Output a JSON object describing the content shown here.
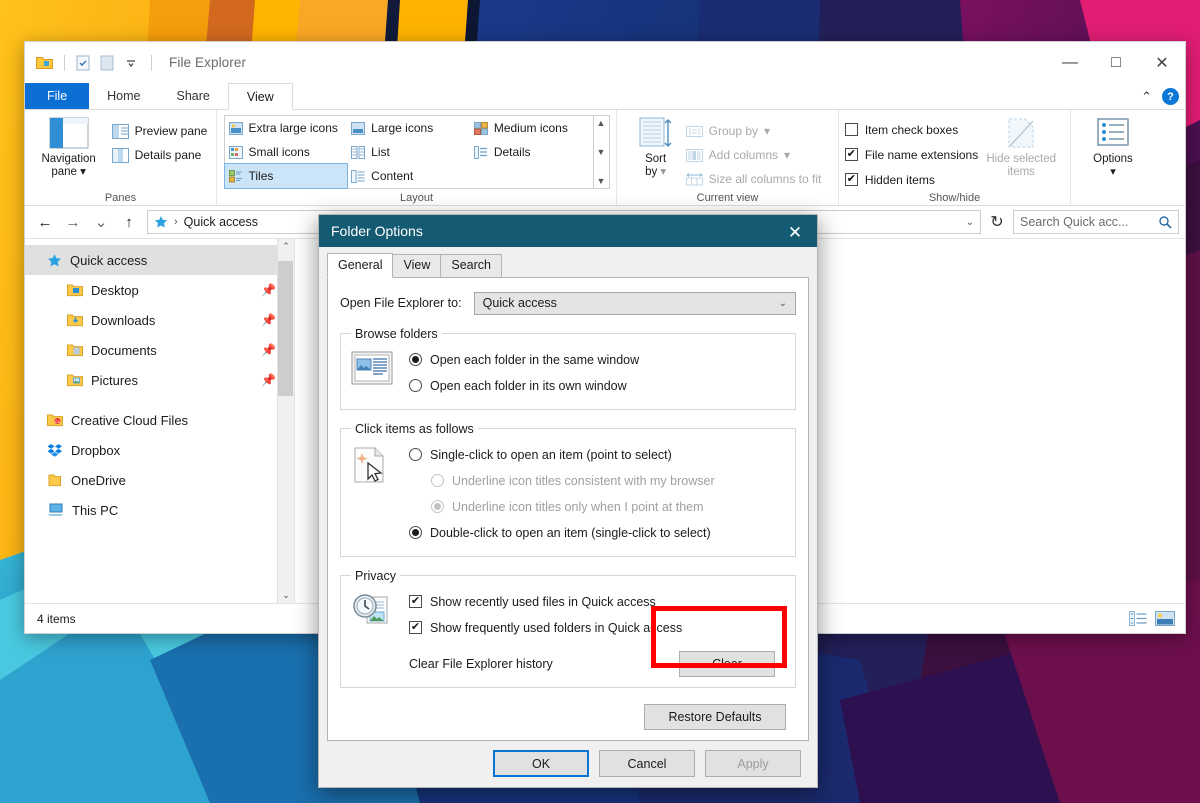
{
  "window": {
    "title": "File Explorer",
    "quick_access_toolbar": [
      "folder-icon",
      "properties-icon",
      "new-folder-icon",
      "customize-chevron-icon"
    ],
    "controls": {
      "minimize": "—",
      "maximize": "□",
      "close": "✕"
    },
    "ribbon_collapse": "⌃",
    "help": "?"
  },
  "ribbon": {
    "tabs": [
      {
        "label": "File",
        "type": "file"
      },
      {
        "label": "Home",
        "type": "normal"
      },
      {
        "label": "Share",
        "type": "normal"
      },
      {
        "label": "View",
        "type": "active"
      }
    ],
    "groups": [
      {
        "name": "Panes",
        "label": "Panes",
        "big_button": {
          "label_line1": "Navigation",
          "label_line2": "pane",
          "icon": "navigation-pane-icon",
          "has_dropdown": true
        },
        "items": [
          {
            "label": "Preview pane",
            "icon": "preview-pane-icon"
          },
          {
            "label": "Details pane",
            "icon": "details-pane-icon"
          }
        ]
      },
      {
        "name": "Layout",
        "label": "Layout",
        "gallery": [
          {
            "label": "Extra large icons",
            "icon": "extra-large-icons-icon",
            "selected": false
          },
          {
            "label": "Large icons",
            "icon": "large-icons-icon",
            "selected": false
          },
          {
            "label": "Medium icons",
            "icon": "medium-icons-icon",
            "selected": false
          },
          {
            "label": "Small icons",
            "icon": "small-icons-icon",
            "selected": false
          },
          {
            "label": "List",
            "icon": "list-view-icon",
            "selected": false
          },
          {
            "label": "Details",
            "icon": "details-view-icon",
            "selected": false
          },
          {
            "label": "Tiles",
            "icon": "tiles-view-icon",
            "selected": true
          },
          {
            "label": "Content",
            "icon": "content-view-icon",
            "selected": false
          }
        ]
      },
      {
        "name": "Current view",
        "label": "Current view",
        "big_button": {
          "label_line1": "Sort",
          "label_line2": "by",
          "icon": "sort-by-icon",
          "has_dropdown": true
        },
        "items": [
          {
            "label": "Group by",
            "icon": "group-by-icon",
            "dim": true,
            "has_dropdown": true
          },
          {
            "label": "Add columns",
            "icon": "add-columns-icon",
            "dim": true,
            "has_dropdown": true
          },
          {
            "label": "Size all columns to fit",
            "icon": "size-columns-icon",
            "dim": true,
            "has_dropdown": false
          }
        ]
      },
      {
        "name": "Show/hide",
        "label": "Show/hide",
        "checkboxes": [
          {
            "label": "Item check boxes",
            "checked": false
          },
          {
            "label": "File name extensions",
            "checked": true
          },
          {
            "label": "Hidden items",
            "checked": true
          }
        ],
        "big_button": {
          "label_line1": "Hide selected",
          "label_line2": "items",
          "icon": "hide-selected-items-icon",
          "dim": true
        }
      },
      {
        "name": "Options",
        "label": "",
        "big_button": {
          "label_line1": "Options",
          "label_line2": "",
          "icon": "options-icon",
          "has_dropdown": true
        }
      }
    ]
  },
  "address": {
    "back": "←",
    "forward": "→",
    "recent": "⌄",
    "up": "↑",
    "crumb_icon": "quick-access-star-icon",
    "crumb": "Quick access",
    "separator": "›",
    "dropdown": "⌄",
    "refresh": "↻",
    "search_placeholder": "Search Quick acc...",
    "search_icon": "search-icon"
  },
  "navpane": {
    "items": [
      {
        "label": "Quick access",
        "icon": "quick-access-star-icon",
        "selected": true,
        "child": false,
        "pinned": false
      },
      {
        "label": "Desktop",
        "icon": "desktop-folder-icon",
        "selected": false,
        "child": true,
        "pinned": true
      },
      {
        "label": "Downloads",
        "icon": "downloads-folder-icon",
        "selected": false,
        "child": true,
        "pinned": true
      },
      {
        "label": "Documents",
        "icon": "documents-folder-icon",
        "selected": false,
        "child": true,
        "pinned": true
      },
      {
        "label": "Pictures",
        "icon": "pictures-folder-icon",
        "selected": false,
        "child": true,
        "pinned": true
      },
      {
        "label": "Creative Cloud Files",
        "icon": "creative-cloud-folder-icon",
        "selected": false,
        "child": false,
        "pinned": false
      },
      {
        "label": "Dropbox",
        "icon": "dropbox-icon",
        "selected": false,
        "child": false,
        "pinned": false
      },
      {
        "label": "OneDrive",
        "icon": "onedrive-folder-icon",
        "selected": false,
        "child": false,
        "pinned": false
      },
      {
        "label": "This PC",
        "icon": "this-pc-icon",
        "selected": false,
        "child": false,
        "pinned": false
      }
    ],
    "scroll_up": "⌃",
    "scroll_down": "⌄"
  },
  "status": {
    "item_count": "4 items",
    "view_details_icon": "details-view-toggle-icon",
    "view_large_icon": "large-icons-view-toggle-icon"
  },
  "dialog": {
    "title": "Folder Options",
    "close": "✕",
    "tabs": [
      {
        "label": "General",
        "active": true
      },
      {
        "label": "View",
        "active": false
      },
      {
        "label": "Search",
        "active": false
      }
    ],
    "open_to": {
      "label": "Open File Explorer to:",
      "value": "Quick access",
      "chevron": "⌄"
    },
    "browse_folders": {
      "legend": "Browse folders",
      "icon": "browse-folders-icon",
      "options": [
        {
          "label": "Open each folder in the same window",
          "checked": true
        },
        {
          "label": "Open each folder in its own window",
          "checked": false
        }
      ]
    },
    "click_items": {
      "legend": "Click items as follows",
      "icon": "click-items-icon",
      "options": [
        {
          "label": "Single-click to open an item (point to select)",
          "checked": false,
          "sub": false,
          "dim": false
        },
        {
          "label": "Underline icon titles consistent with my browser",
          "checked": false,
          "sub": true,
          "dim": true
        },
        {
          "label": "Underline icon titles only when I point at them",
          "checked": true,
          "sub": true,
          "dim": true
        },
        {
          "label": "Double-click to open an item (single-click to select)",
          "checked": true,
          "sub": false,
          "dim": false
        }
      ]
    },
    "privacy": {
      "legend": "Privacy",
      "icon": "privacy-clock-icon",
      "checkboxes": [
        {
          "label": "Show recently used files in Quick access",
          "checked": true
        },
        {
          "label": "Show frequently used folders in Quick access",
          "checked": true
        }
      ],
      "clear_label": "Clear File Explorer history",
      "clear_button": "Clear"
    },
    "restore_defaults": "Restore Defaults",
    "footer": {
      "ok": "OK",
      "cancel": "Cancel",
      "apply": "Apply"
    }
  },
  "annotation": {
    "highlight_color": "#ff0000",
    "target": "clear-button"
  }
}
